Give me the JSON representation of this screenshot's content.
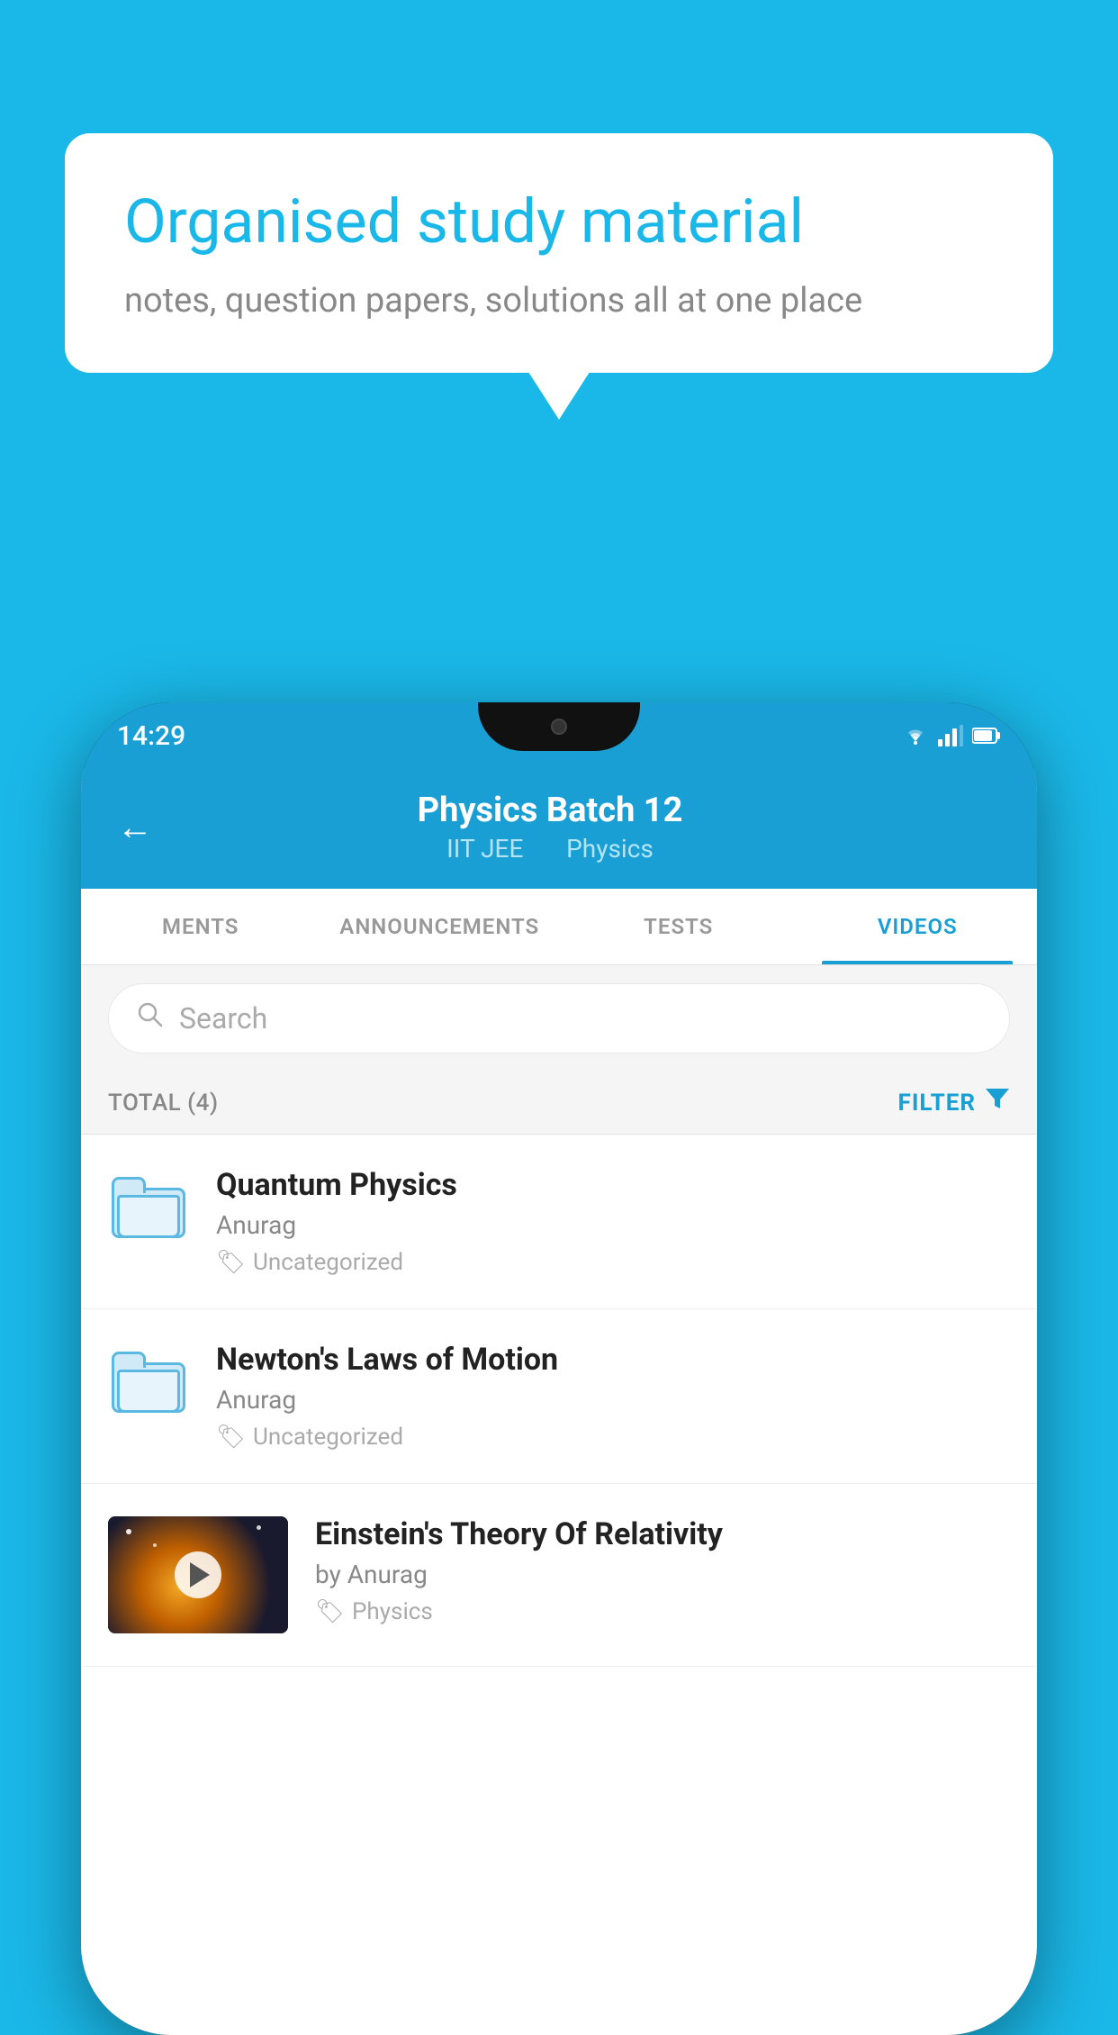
{
  "background_color": "#1ab8e8",
  "speech_bubble": {
    "title": "Organised study material",
    "subtitle": "notes, question papers, solutions all at one place"
  },
  "phone": {
    "status_bar": {
      "time": "14:29",
      "icons": [
        "wifi",
        "signal",
        "battery"
      ]
    },
    "header": {
      "back_label": "←",
      "title": "Physics Batch 12",
      "subtitle_part1": "IIT JEE",
      "subtitle_part2": "Physics"
    },
    "tabs": [
      {
        "label": "MENTS",
        "active": false
      },
      {
        "label": "ANNOUNCEMENTS",
        "active": false
      },
      {
        "label": "TESTS",
        "active": false
      },
      {
        "label": "VIDEOS",
        "active": true
      }
    ],
    "search": {
      "placeholder": "Search"
    },
    "filter_bar": {
      "total_label": "TOTAL (4)",
      "filter_label": "FILTER"
    },
    "videos": [
      {
        "title": "Quantum Physics",
        "author": "Anurag",
        "tag": "Uncategorized",
        "type": "folder"
      },
      {
        "title": "Newton's Laws of Motion",
        "author": "Anurag",
        "tag": "Uncategorized",
        "type": "folder"
      },
      {
        "title": "Einstein's Theory Of Relativity",
        "author": "by Anurag",
        "tag": "Physics",
        "type": "video"
      }
    ]
  }
}
